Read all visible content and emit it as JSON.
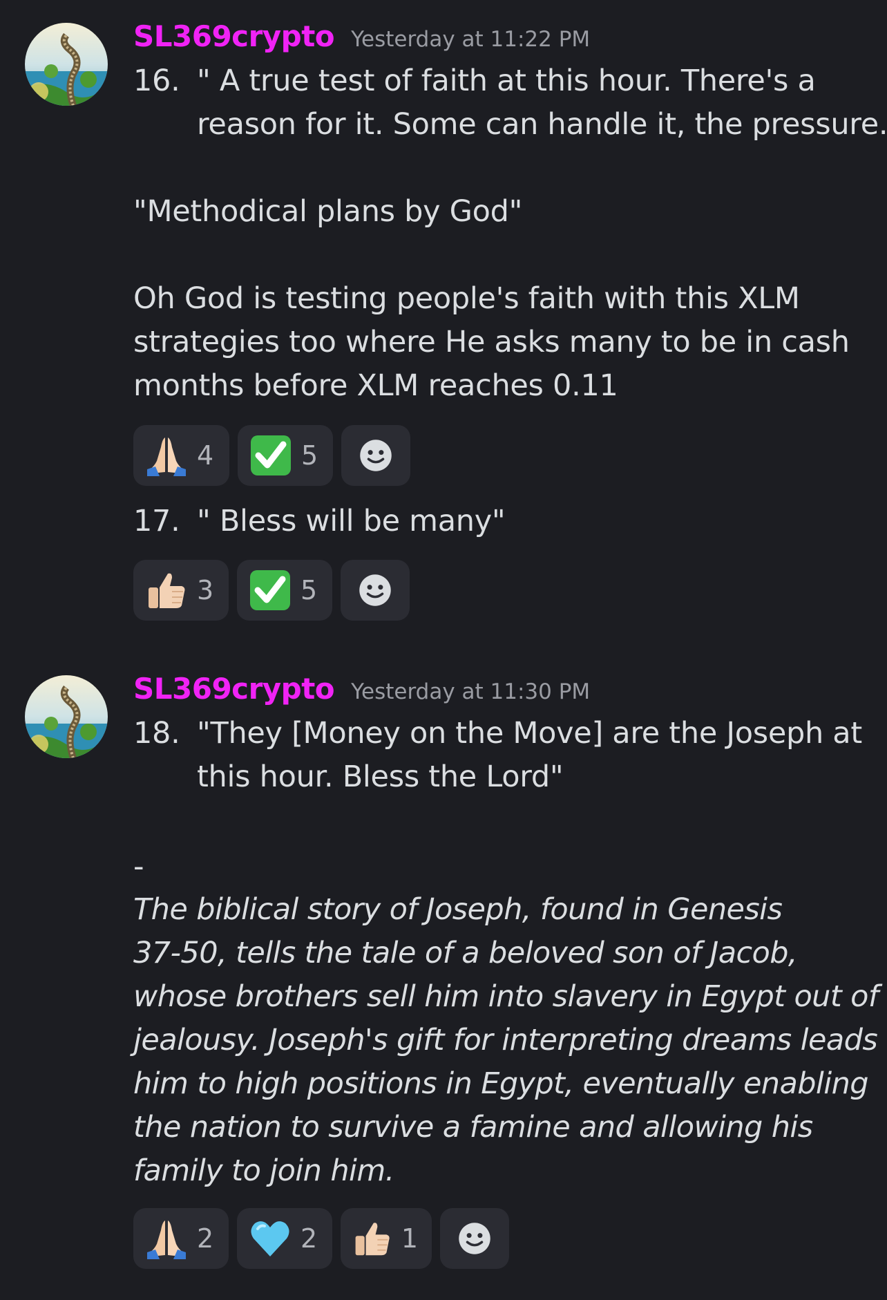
{
  "messages": [
    {
      "username": "SL369crypto",
      "timestamp": "Yesterday at 11:22 PM",
      "avatar": "stairway-to-heaven-avatar",
      "items": [
        {
          "number": "16.",
          "lines": [
            "\" A true test of faith at this hour.  There's a",
            "reason for it. Some can handle it, the pressure."
          ],
          "extra_lines": [
            "\"Methodical plans by God\"",
            "Oh God is testing people's faith with this XLM",
            "strategies too where He asks many to be in cash",
            "months before XLM reaches 0.11"
          ],
          "reactions": [
            {
              "icon": "praying-hands-icon",
              "count": "4"
            },
            {
              "icon": "check-mark-button-icon",
              "count": "5"
            }
          ]
        },
        {
          "number": "17.",
          "lines": [
            "\" Bless will be many\""
          ],
          "reactions": [
            {
              "icon": "thumbs-up-icon",
              "count": "3"
            },
            {
              "icon": "check-mark-button-icon",
              "count": "5"
            }
          ]
        }
      ]
    },
    {
      "username": "SL369crypto",
      "timestamp": "Yesterday at 11:30 PM",
      "avatar": "stairway-to-heaven-avatar",
      "items": [
        {
          "number": "18.",
          "lines": [
            "\"They [Money on the Move] are the Joseph at",
            "this hour. Bless the Lord\""
          ],
          "separator": "-",
          "italic_lines": [
            "The biblical story of Joseph, found in Genesis",
            "37-50, tells the tale of a beloved son of Jacob,",
            "whose brothers sell him into slavery in Egypt out of",
            "jealousy. Joseph's gift for interpreting dreams leads",
            "him to high positions in Egypt, eventually enabling",
            "the nation to survive a famine and allowing his",
            "family to join him."
          ],
          "reactions": [
            {
              "icon": "praying-hands-icon",
              "count": "2"
            },
            {
              "icon": "light-blue-heart-icon",
              "count": "2"
            },
            {
              "icon": "thumbs-up-icon",
              "count": "1"
            }
          ]
        }
      ]
    }
  ],
  "add_reaction_icon": "smiley-add-reaction-icon",
  "colors": {
    "background": "#1c1d22",
    "username": "#f023f5",
    "timestamp": "#9a9ca3",
    "text": "#dbdee1",
    "reaction_bg": "#2b2c33"
  }
}
